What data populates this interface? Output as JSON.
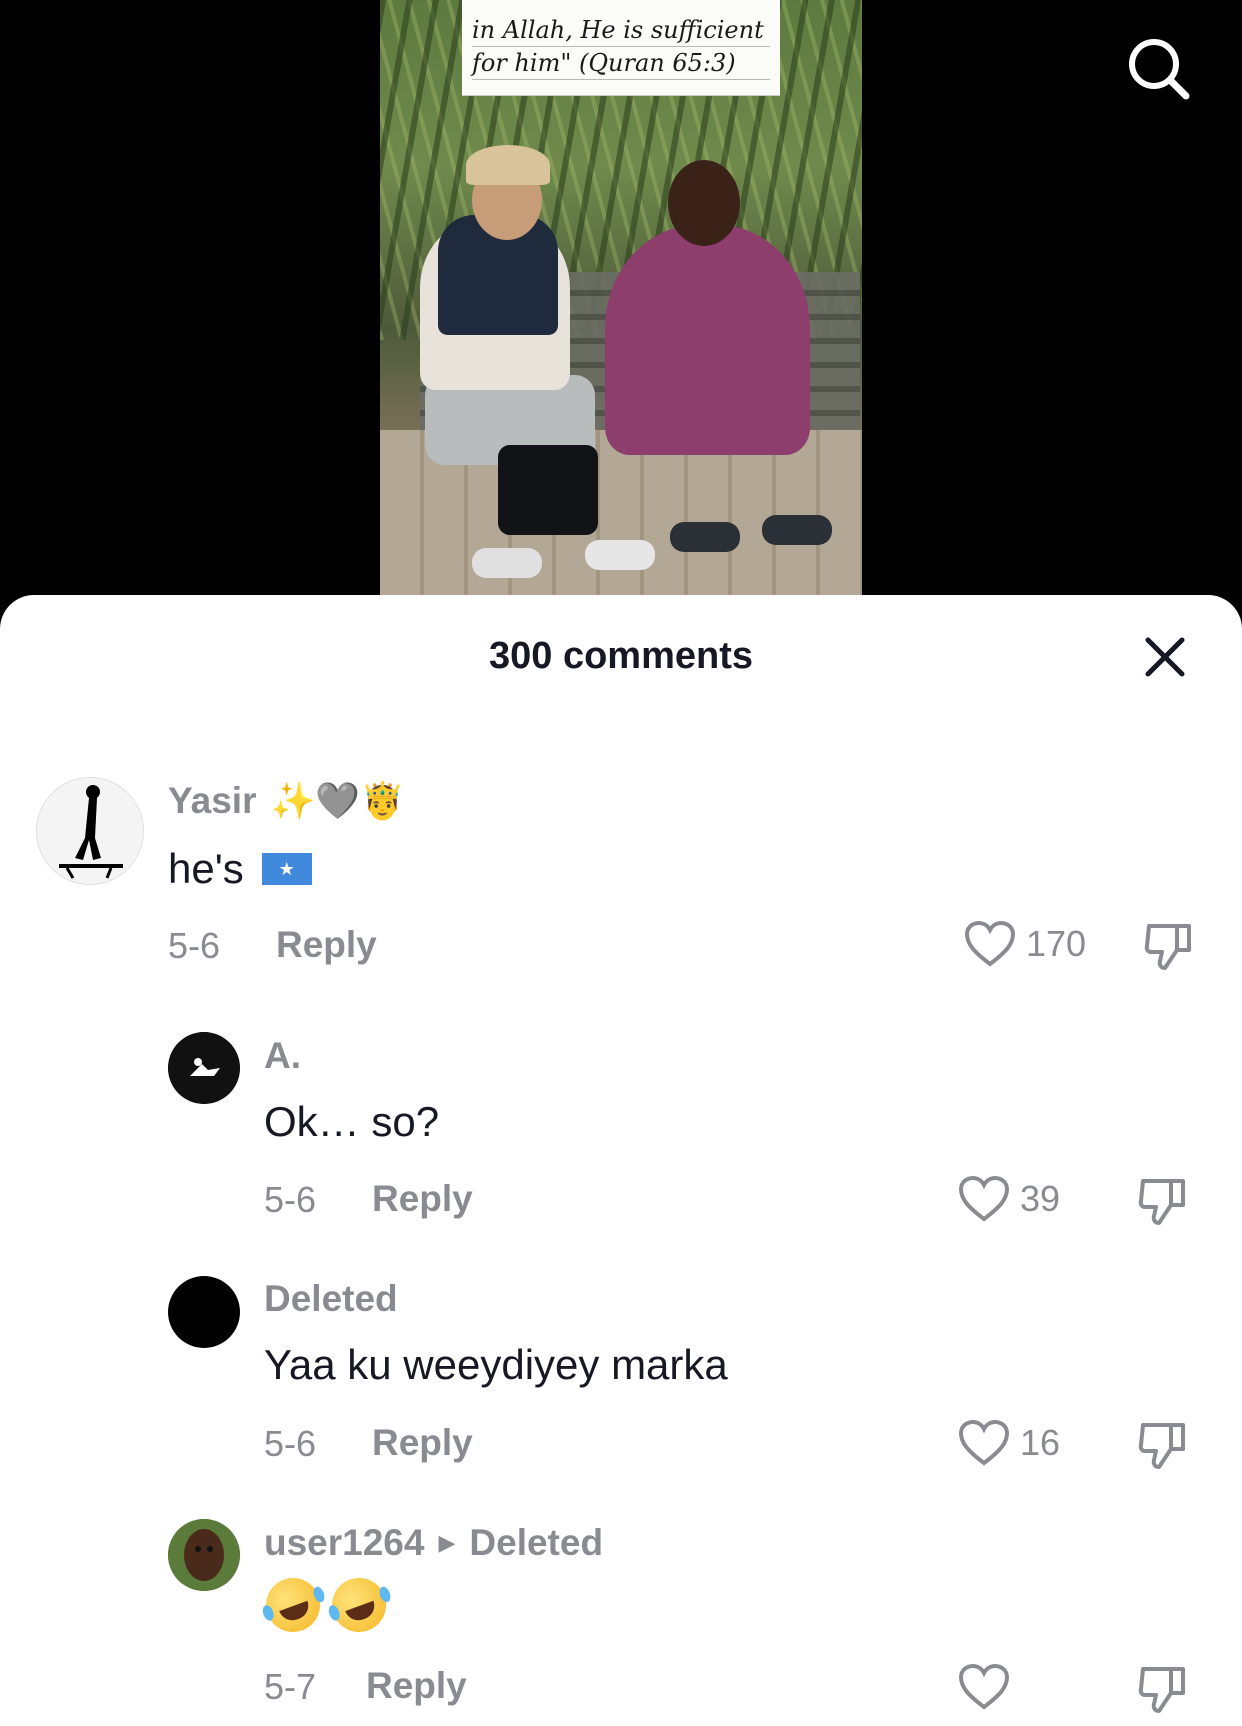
{
  "video": {
    "caption_line1": "in Allah, He is sufficient",
    "caption_line2": "for him\" (Quran 65:3)"
  },
  "header": {
    "search_icon": "search-icon"
  },
  "sheet": {
    "title": "300 comments",
    "close_icon": "close-icon"
  },
  "comments": [
    {
      "user": "Yasir",
      "user_emojis": "✨🩶🤴",
      "text": "he's",
      "text_emoji": "somalia-flag",
      "date": "5-6",
      "reply": "Reply",
      "likes": "170"
    },
    {
      "user": "A.",
      "text": "Ok… so?",
      "date": "5-6",
      "reply": "Reply",
      "likes": "39"
    },
    {
      "user": "Deleted",
      "text": "Yaa ku weeydiyey marka",
      "date": "5-6",
      "reply": "Reply",
      "likes": "16"
    },
    {
      "user": "user1264",
      "reply_to": "Deleted",
      "text_emoji": "rolling-on-floor-laughing x2",
      "date": "5-7",
      "reply": "Reply",
      "likes": ""
    }
  ],
  "colors": {
    "sheet_bg": "#ffffff",
    "primary_text": "#161823",
    "secondary_text": "#8a8b91"
  }
}
